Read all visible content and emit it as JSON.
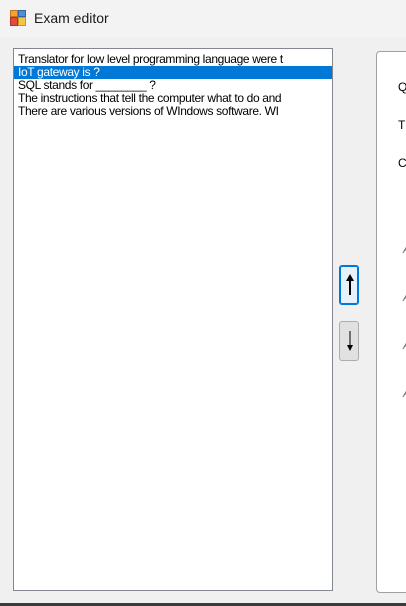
{
  "window": {
    "title": "Exam editor",
    "icon": "app-form-icon"
  },
  "question_list": {
    "items": [
      {
        "text": "Translator for low level programming language were t"
      },
      {
        "text": "IoT gateway is ?"
      },
      {
        "text": "SQL stands for ________ ?"
      },
      {
        "text": "The instructions that tell the computer what to do and"
      },
      {
        "text": "There are various versions of WIndows software.  WI"
      }
    ],
    "selected_index": 1
  },
  "move_buttons": {
    "up_icon": "arrow-up-icon",
    "down_icon": "arrow-down-icon"
  },
  "details_panel": {
    "labels": [
      "Q",
      "T",
      "C"
    ],
    "answer_labels": [
      "A",
      "A",
      "A",
      "A"
    ]
  },
  "colors": {
    "selection": "#0078d7",
    "selection_text": "#ffffff",
    "background": "#f0f0f0",
    "list_border": "#828790"
  }
}
